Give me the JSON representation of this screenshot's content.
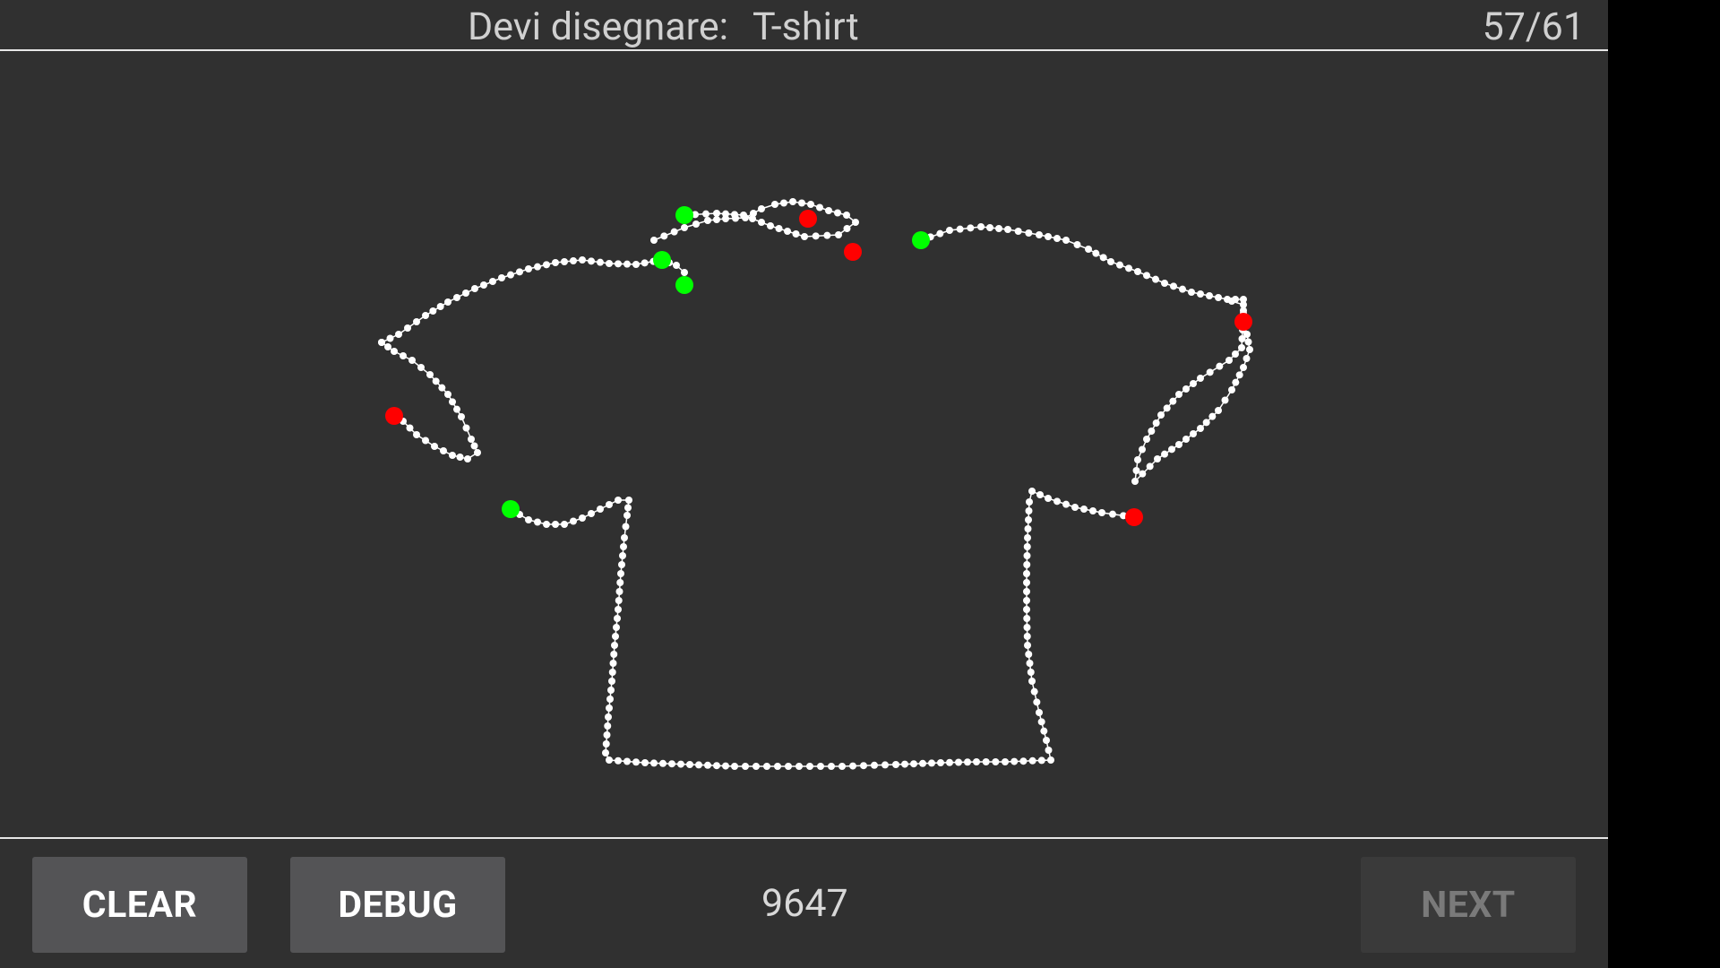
{
  "header": {
    "prompt_label": "Devi disegnare:",
    "prompt_word": "T-shirt",
    "progress": "57/61"
  },
  "footer": {
    "clear_label": "CLEAR",
    "debug_label": "DEBUG",
    "score": "9647",
    "next_label": "NEXT"
  },
  "colors": {
    "background": "#303030",
    "stroke": "#ffffff",
    "stroke_start": "#00ff00",
    "stroke_end": "#ff0000",
    "button": "#545456",
    "button_disabled": "#3a3a3a"
  }
}
